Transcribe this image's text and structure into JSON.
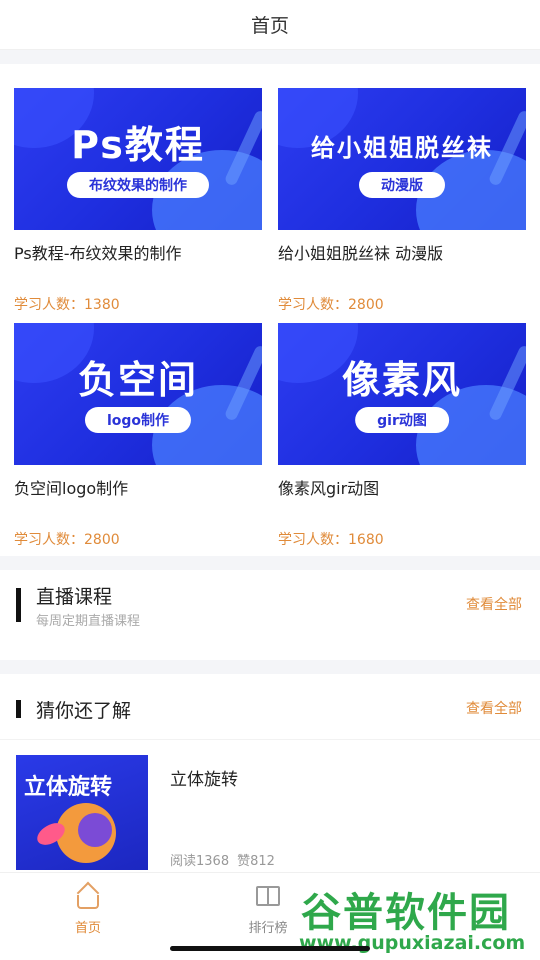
{
  "header": {
    "title": "首页"
  },
  "courses": [
    {
      "thumb_big": "Ps教程",
      "thumb_pill": "布纹效果的制作",
      "title": "Ps教程-布纹效果的制作",
      "learners": "学习人数：1380"
    },
    {
      "thumb_big": "给小姐姐脱丝袜",
      "thumb_pill": "动漫版",
      "title": "给小姐姐脱丝袜 动漫版",
      "learners": "学习人数：2800"
    },
    {
      "thumb_big": "负空间",
      "thumb_pill": "logo制作",
      "title": "负空间logo制作",
      "learners": "学习人数：2800"
    },
    {
      "thumb_big": "像素风",
      "thumb_pill": "gir动图",
      "title": "像素风gir动图",
      "learners": "学习人数：1680"
    }
  ],
  "live_section": {
    "title": "直播课程",
    "subtitle": "每周定期直播课程",
    "see_all": "查看全部"
  },
  "guess_section": {
    "title": "猜你还了解",
    "see_all": "查看全部"
  },
  "article": {
    "thumb_text": "立体旋转",
    "title": "立体旋转",
    "reads": "阅读1368",
    "likes": "赞812"
  },
  "tabbar": {
    "home": "首页",
    "ranking": "排行榜"
  },
  "watermark": {
    "main": "谷普软件园",
    "url": "www.gupuxiazai.com"
  },
  "colors": {
    "accent": "#e08b3a",
    "thumb_blue": "#1f2fe0",
    "watermark_green": "#2fa84b"
  }
}
